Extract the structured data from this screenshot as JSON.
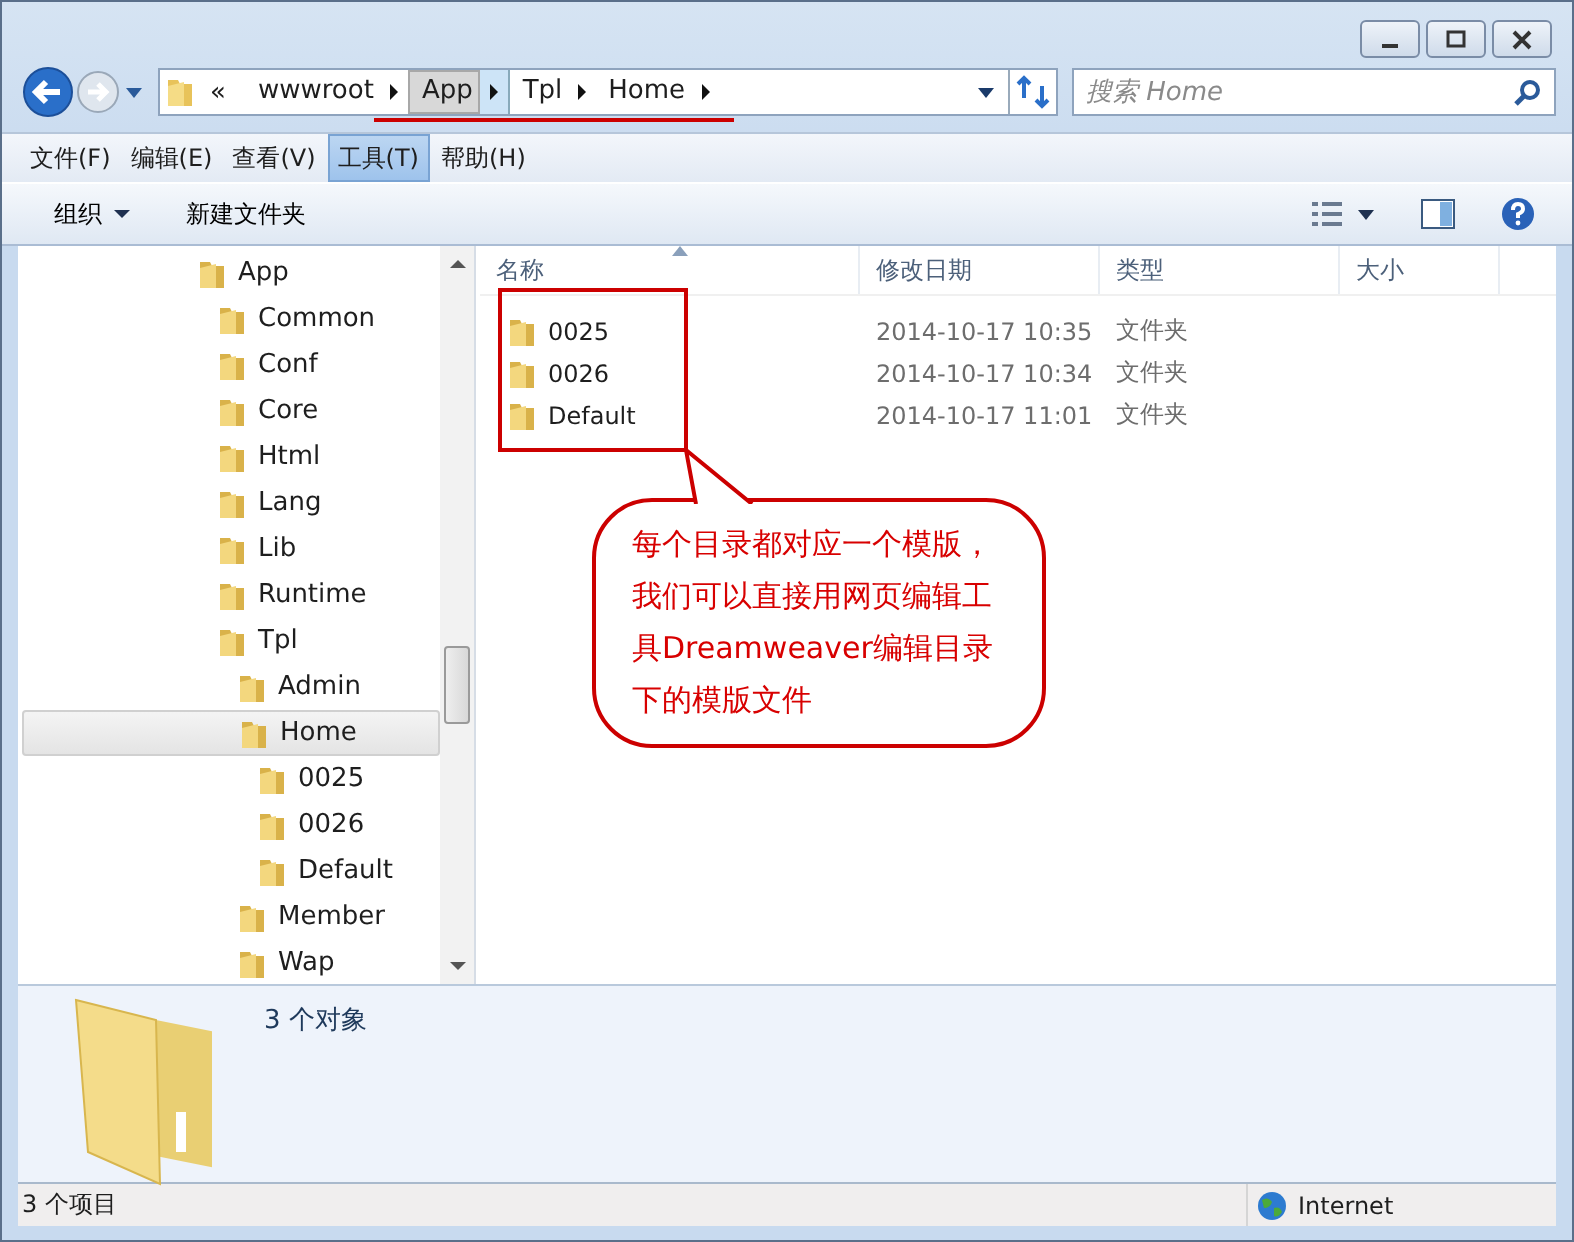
{
  "address_bar": {
    "overflow": "«",
    "crumbs": [
      {
        "label": "wwwroot",
        "selected": false
      },
      {
        "label": "App",
        "selected": true
      },
      {
        "label": "Tpl",
        "selected": false
      },
      {
        "label": "Home",
        "selected": false
      }
    ]
  },
  "search": {
    "placeholder": "搜索 Home"
  },
  "menu": [
    {
      "label": "文件(F)",
      "selected": false
    },
    {
      "label": "编辑(E)",
      "selected": false
    },
    {
      "label": "查看(V)",
      "selected": false
    },
    {
      "label": "工具(T)",
      "selected": true
    },
    {
      "label": "帮助(H)",
      "selected": false
    }
  ],
  "toolbar": {
    "organize": "组织",
    "new_folder": "新建文件夹"
  },
  "tree": [
    {
      "label": "App",
      "selected": false,
      "children": [
        {
          "label": "Common",
          "selected": false
        },
        {
          "label": "Conf",
          "selected": false
        },
        {
          "label": "Core",
          "selected": false
        },
        {
          "label": "Html",
          "selected": false
        },
        {
          "label": "Lang",
          "selected": false
        },
        {
          "label": "Lib",
          "selected": false
        },
        {
          "label": "Runtime",
          "selected": false
        },
        {
          "label": "Tpl",
          "selected": false,
          "children": [
            {
              "label": "Admin",
              "selected": false
            },
            {
              "label": "Home",
              "selected": true,
              "children": [
                {
                  "label": "0025",
                  "selected": false
                },
                {
                  "label": "0026",
                  "selected": false
                },
                {
                  "label": "Default",
                  "selected": false
                }
              ]
            },
            {
              "label": "Member",
              "selected": false
            },
            {
              "label": "Wap",
              "selected": false
            }
          ]
        }
      ]
    }
  ],
  "table": {
    "columns": [
      "名称",
      "修改日期",
      "类型",
      "大小"
    ],
    "rows": [
      {
        "name": "0025",
        "modified": "2014-10-17 10:35",
        "type": "文件夹"
      },
      {
        "name": "0026",
        "modified": "2014-10-17 10:34",
        "type": "文件夹"
      },
      {
        "name": "Default",
        "modified": "2014-10-17 11:01",
        "type": "文件夹"
      }
    ]
  },
  "callout": "每个目录都对应一个模版，我们可以直接用网页编辑工具Dreamweaver编辑目录下的模版文件",
  "details": {
    "summary": "3 个对象"
  },
  "status_bar": {
    "items": "3 个项目",
    "zone": "Internet"
  }
}
